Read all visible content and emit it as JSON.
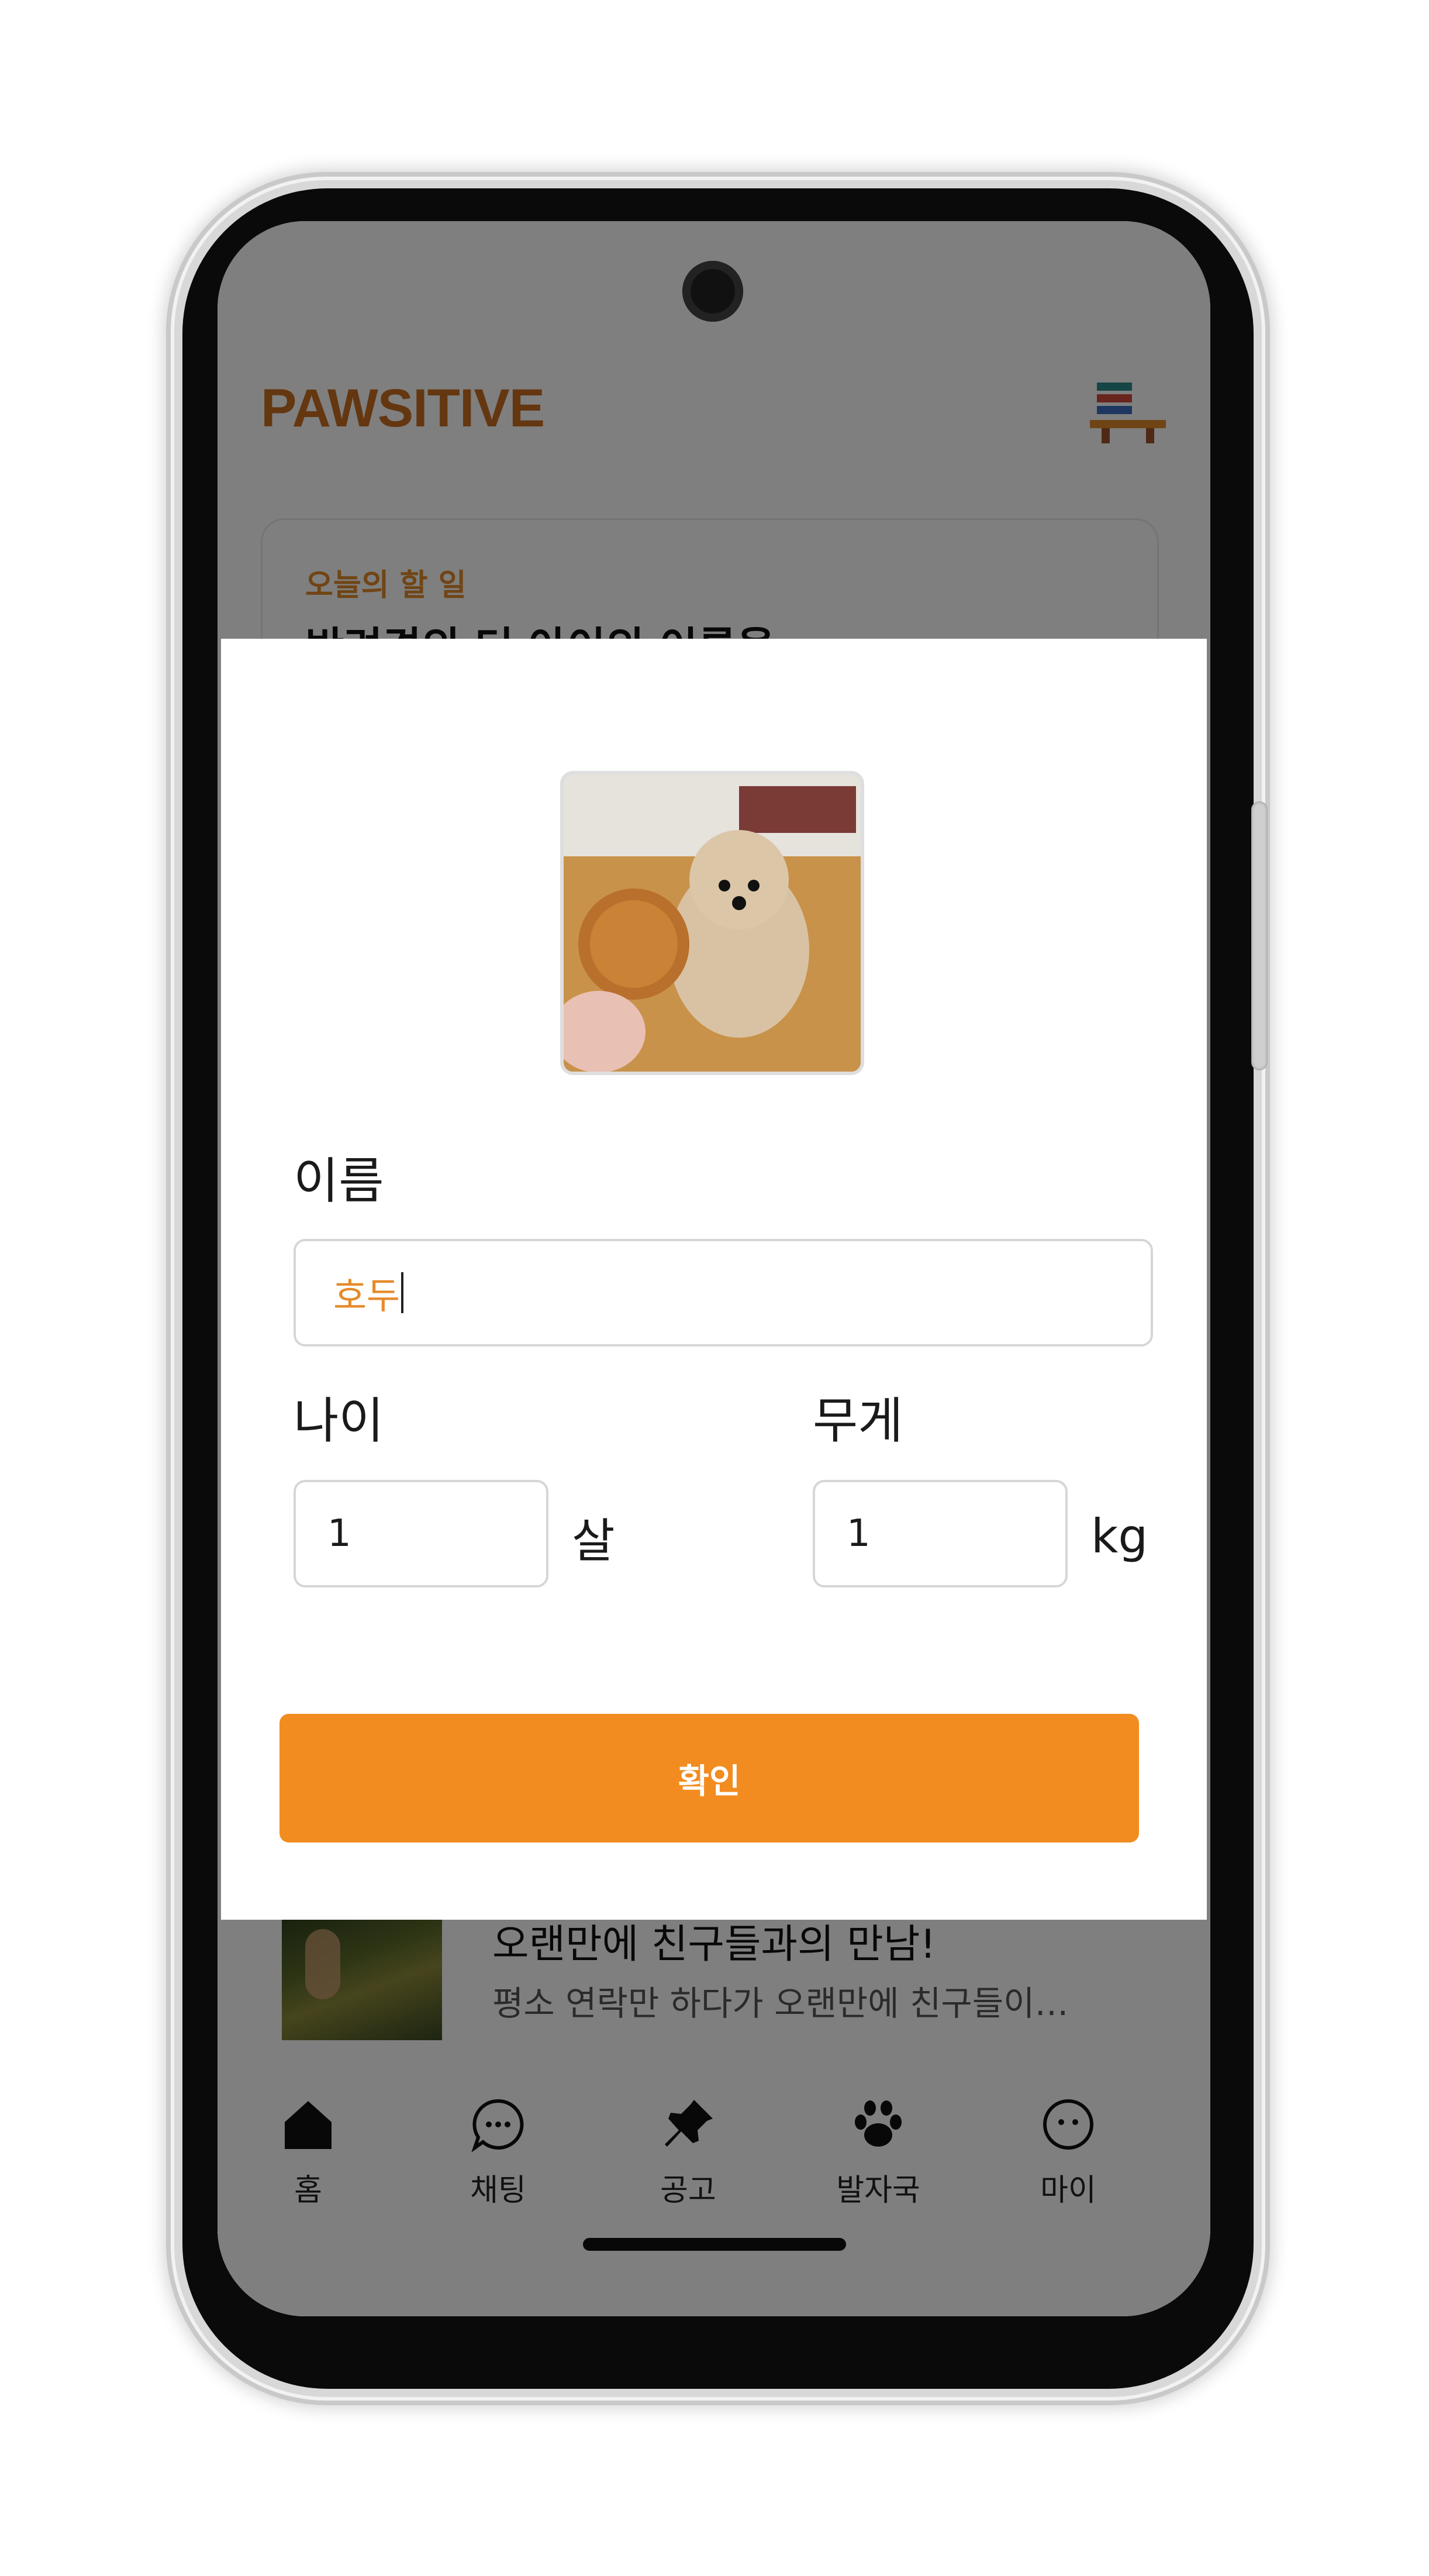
{
  "app": {
    "brand": "PAWSITIVE"
  },
  "todo": {
    "label": "오늘의 할 일",
    "title": "반려견의 더 아이의 이름을"
  },
  "post": {
    "title": "오랜만에 친구들과의 만남!",
    "excerpt": "평소 연락만 하다가 오랜만에 친구들이…"
  },
  "modal": {
    "name_label": "이름",
    "name_value": "호두",
    "age_label": "나이",
    "age_value": "1",
    "age_unit": "살",
    "weight_label": "무게",
    "weight_value": "1",
    "weight_unit": "kg",
    "confirm_label": "확인"
  },
  "nav": {
    "items": [
      {
        "label": "홈",
        "icon": "home-icon"
      },
      {
        "label": "채팅",
        "icon": "chat-icon"
      },
      {
        "label": "공고",
        "icon": "pin-icon"
      },
      {
        "label": "발자국",
        "icon": "paw-icon"
      },
      {
        "label": "마이",
        "icon": "profile-icon"
      }
    ]
  },
  "colors": {
    "brand": "#c96e22",
    "accent": "#f28c20",
    "scrim": "rgba(0,0,0,0.5)"
  }
}
